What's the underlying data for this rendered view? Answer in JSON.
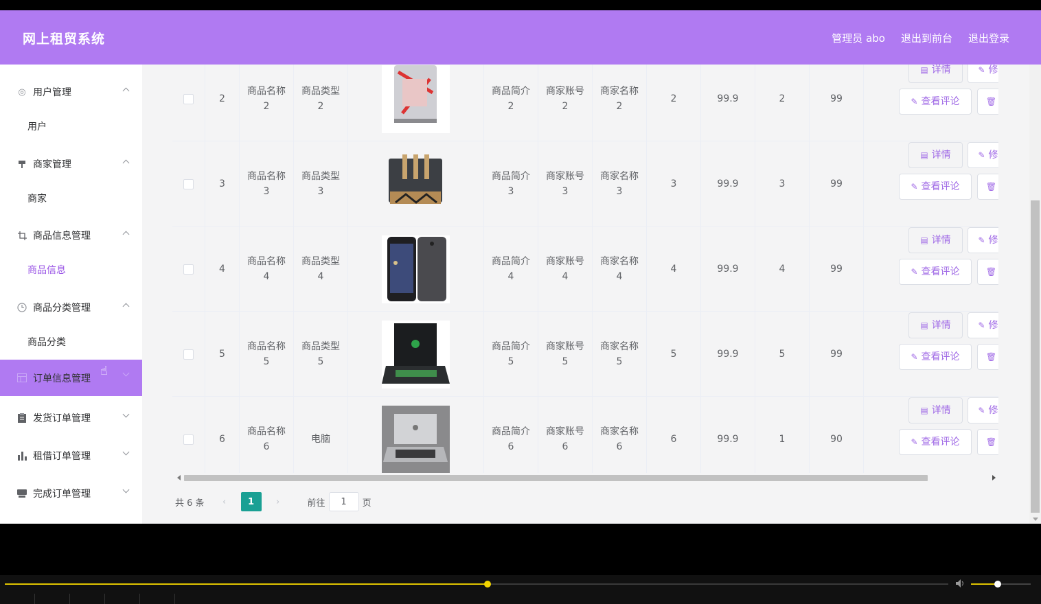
{
  "header": {
    "title": "网上租贸系统",
    "admin_label": "管理员 abo",
    "back_to_front": "退出到前台",
    "logout": "退出登录"
  },
  "sidebar": {
    "groups": [
      {
        "label": "用户管理",
        "icon": "dashboard-icon",
        "expanded": true,
        "sub": "用户"
      },
      {
        "label": "商家管理",
        "icon": "pushpin-icon",
        "expanded": true,
        "sub": "商家"
      },
      {
        "label": "商品信息管理",
        "icon": "crop-icon",
        "expanded": true,
        "sub": "商品信息"
      },
      {
        "label": "商品分类管理",
        "icon": "clock-icon",
        "expanded": true,
        "sub": "商品分类"
      },
      {
        "label": "订单信息管理",
        "icon": "grid-icon",
        "expanded": false
      },
      {
        "label": "发货订单管理",
        "icon": "clipboard-icon",
        "expanded": false
      },
      {
        "label": "租借订单管理",
        "icon": "bar-chart-icon",
        "expanded": false
      },
      {
        "label": "完成订单管理",
        "icon": "printer-icon",
        "expanded": false
      }
    ],
    "selected_sub": "商品信息",
    "active_color": "#b07af2"
  },
  "table": {
    "rows": [
      {
        "id": "2",
        "name": "商品名称\n2",
        "type": "商品类型\n2",
        "image": "gaming-pc",
        "intro": "商品简介\n2",
        "account": "商家账号\n2",
        "merchant": "商家名称\n2",
        "c1": "2",
        "price": "99.9",
        "c2": "2",
        "c3": "99"
      },
      {
        "id": "3",
        "name": "商品名称\n3",
        "type": "商品类型\n3",
        "image": "audio-amplifier",
        "intro": "商品简介\n3",
        "account": "商家账号\n3",
        "merchant": "商家名称\n3",
        "c1": "3",
        "price": "99.9",
        "c2": "3",
        "c3": "99"
      },
      {
        "id": "4",
        "name": "商品名称\n4",
        "type": "商品类型\n4",
        "image": "smartphone",
        "intro": "商品简介\n4",
        "account": "商家账号\n4",
        "merchant": "商家名称\n4",
        "c1": "4",
        "price": "99.9",
        "c2": "4",
        "c3": "99"
      },
      {
        "id": "5",
        "name": "商品名称\n5",
        "type": "商品类型\n5",
        "image": "gaming-laptop",
        "intro": "商品简介\n5",
        "account": "商家账号\n5",
        "merchant": "商家名称\n5",
        "c1": "5",
        "price": "99.9",
        "c2": "5",
        "c3": "99"
      },
      {
        "id": "6",
        "name": "商品名称\n6",
        "type": "电脑",
        "image": "macbook",
        "intro": "商品简介\n6",
        "account": "商家账号\n6",
        "merchant": "商家名称\n6",
        "c1": "6",
        "price": "99.9",
        "c2": "1",
        "c3": "90"
      }
    ],
    "actions": {
      "detail": "详情",
      "edit": "修",
      "comments": "查看评论",
      "delete_icon": "trash-icon"
    }
  },
  "pagination": {
    "total": "共 6 条",
    "current": "1",
    "goto_prefix": "前往",
    "goto_value": "1",
    "goto_suffix": "页",
    "accent": "#1aa094"
  },
  "player": {
    "progress": 0.512,
    "volume": 0.45
  }
}
